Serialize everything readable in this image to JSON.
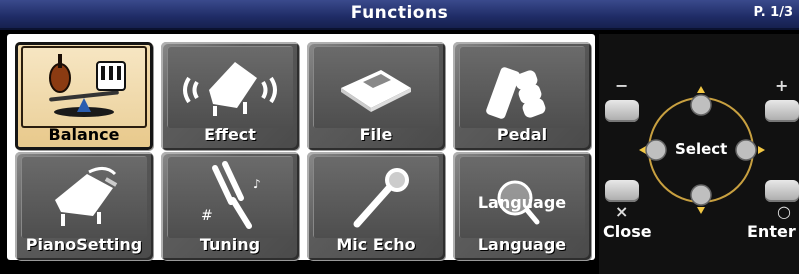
{
  "header": {
    "title": "Functions",
    "page_indicator": "P. 1/3"
  },
  "tiles": [
    {
      "label": "Balance",
      "icon": "balance-icon",
      "selected": true
    },
    {
      "label": "Effect",
      "icon": "effect-icon",
      "selected": false
    },
    {
      "label": "File",
      "icon": "file-icon",
      "selected": false
    },
    {
      "label": "Pedal",
      "icon": "pedal-icon",
      "selected": false
    },
    {
      "label": "PianoSetting",
      "icon": "piano-setting-icon",
      "selected": false
    },
    {
      "label": "Tuning",
      "icon": "tuning-fork-icon",
      "selected": false
    },
    {
      "label": "Mic Echo",
      "icon": "microphone-icon",
      "selected": false
    },
    {
      "label": "Language",
      "icon": "language-icon",
      "selected": false,
      "icon_text": "Language"
    }
  ],
  "controls": {
    "minus_symbol": "−",
    "plus_symbol": "+",
    "close_symbol": "×",
    "enter_symbol": "○",
    "select_label": "Select",
    "close_label": "Close",
    "enter_label": "Enter"
  },
  "colors": {
    "title_bar": "#1f2c66",
    "selected_tile": "#ecd39f",
    "tile": "#5c5c5c"
  }
}
